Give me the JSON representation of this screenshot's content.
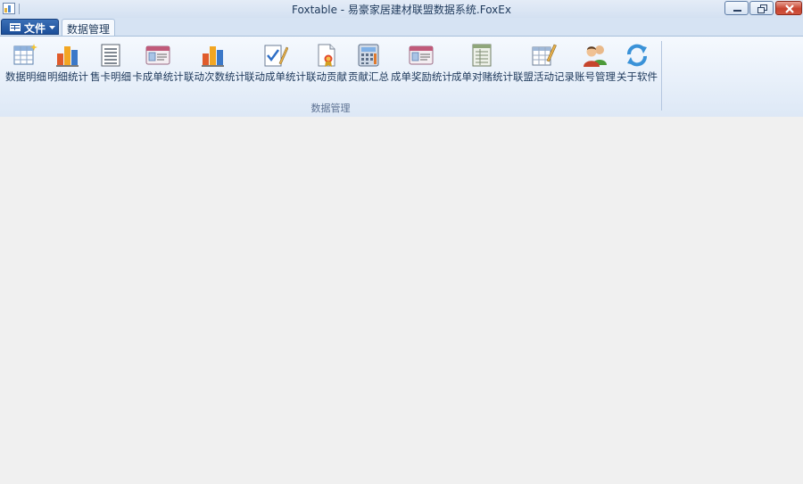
{
  "window": {
    "title": "Foxtable - 易豪家居建材联盟数据系统.FoxEx",
    "controls": [
      "minimize",
      "maximize",
      "close"
    ]
  },
  "menu": {
    "file_label": "文件",
    "active_tab": "数据管理"
  },
  "ribbon": {
    "group_label": "数据管理",
    "buttons": [
      {
        "label": "数据明细",
        "icon": "table-new-icon"
      },
      {
        "label": "明细统计",
        "icon": "bar-chart-icon"
      },
      {
        "label": "售卡明细",
        "icon": "list-icon"
      },
      {
        "label": "卡成单统计",
        "icon": "id-card-icon"
      },
      {
        "label": "联动次数统计",
        "icon": "bar-chart-icon"
      },
      {
        "label": "联动成单统计",
        "icon": "checklist-pen-icon"
      },
      {
        "label": "联动贡献",
        "icon": "certificate-icon"
      },
      {
        "label": "贡献汇总",
        "icon": "calculator-icon"
      },
      {
        "label": "成单奖励统计",
        "icon": "id-card-icon"
      },
      {
        "label": "成单对赌统计",
        "icon": "ledger-icon"
      },
      {
        "label": "联盟活动记录",
        "icon": "table-edit-icon"
      },
      {
        "label": "账号管理",
        "icon": "users-icon"
      },
      {
        "label": "关于软件",
        "icon": "refresh-icon"
      }
    ]
  },
  "colors": {
    "ribbon_bg": "#dde8f6",
    "text": "#1e395b",
    "file_button": "#1c4f9a",
    "close_button": "#c8432f"
  }
}
